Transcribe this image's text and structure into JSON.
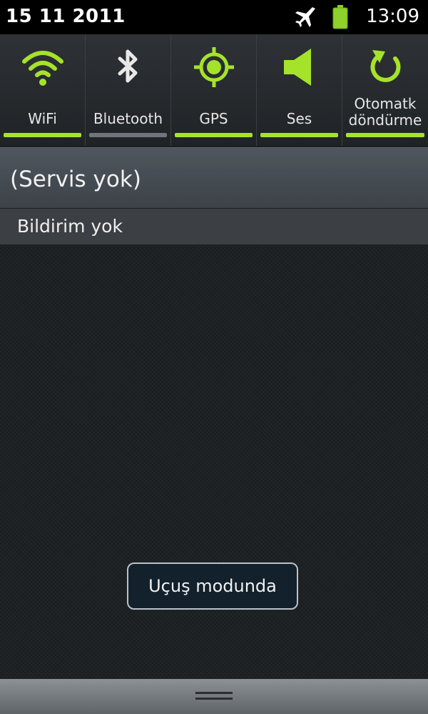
{
  "status_bar": {
    "date": "15 11 2011",
    "time": "13:09",
    "icons": [
      "airplane-icon",
      "battery-icon"
    ]
  },
  "toggles": [
    {
      "id": "wifi",
      "label": "WiFi",
      "icon": "wifi-icon",
      "active": true
    },
    {
      "id": "bluetooth",
      "label": "Bluetooth",
      "icon": "bluetooth-icon",
      "active": false
    },
    {
      "id": "gps",
      "label": "GPS",
      "icon": "gps-icon",
      "active": true
    },
    {
      "id": "sound",
      "label": "Ses",
      "icon": "speaker-icon",
      "active": true
    },
    {
      "id": "autorotate",
      "label_line1": "Otomatk",
      "label_line2": "döndürme",
      "icon": "rotate-icon",
      "active": true
    }
  ],
  "carrier": {
    "text": "(Servis yok)"
  },
  "notifications": {
    "header": "Bildirim yok"
  },
  "toast": {
    "text": "Uçuş modunda"
  },
  "colors": {
    "accent": "#a5e32b",
    "inactive": "#6f757a",
    "status_bg": "#000000",
    "toast_border": "#b9c2c8"
  }
}
